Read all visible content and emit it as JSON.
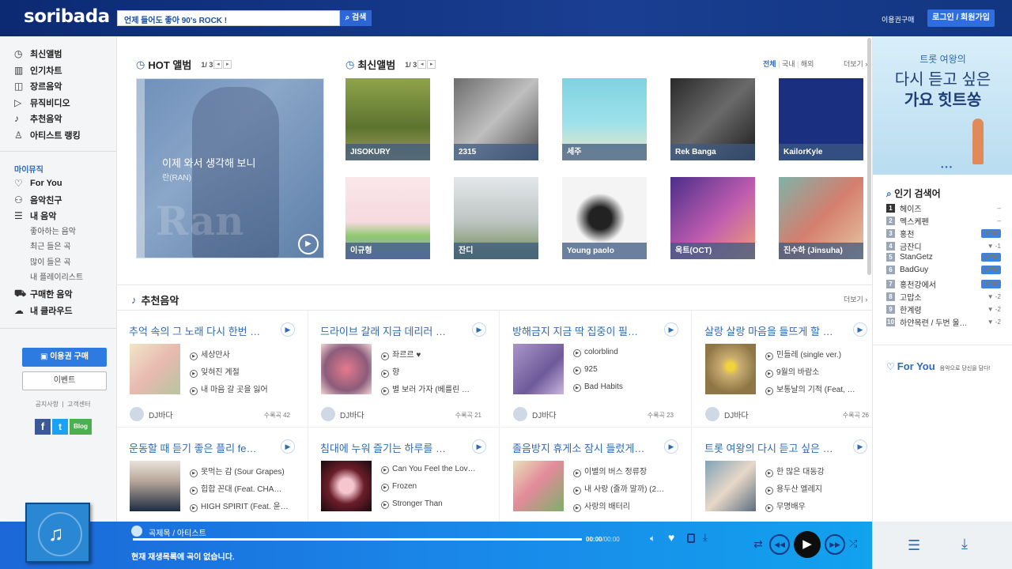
{
  "header": {
    "logo": "soribada",
    "search_value": "언제 들어도 좋아 90's ROCK !",
    "search_btn": "검색",
    "voucher": "이용권구매",
    "login": "로그인 / 회원가입"
  },
  "sidebar": {
    "menu": [
      {
        "label": "최신앨범",
        "icon": "clock-icon"
      },
      {
        "label": "인기차트",
        "icon": "chart-icon"
      },
      {
        "label": "장르음악",
        "icon": "genre-icon"
      },
      {
        "label": "뮤직비디오",
        "icon": "video-icon"
      },
      {
        "label": "추천음악",
        "icon": "note-icon"
      },
      {
        "label": "아티스트 랭킹",
        "icon": "person-icon"
      }
    ],
    "my_title": "마이뮤직",
    "for_you": "For You",
    "friends": "음악친구",
    "my_music": "내 음악",
    "subs": [
      "좋아하는 음악",
      "최근 들은 곡",
      "많이 들은 곡",
      "내 플레이리스트"
    ],
    "purchased": "구매한 음악",
    "cloud": "내 클라우드",
    "buy_btn": "이용권 구매",
    "event_btn": "이벤트",
    "notice": "공지사항",
    "support": "고객센터",
    "blog": "Blog"
  },
  "hot": {
    "title": "HOT 앨범",
    "page": "1/ 3",
    "song": "이제 와서 생각해 보니",
    "artist": "란(RAN)"
  },
  "latest": {
    "title": "최신앨범",
    "page": "1/ 3",
    "filters": [
      "전체",
      "국내",
      "해외"
    ],
    "more": "더보기 ›",
    "albums": [
      "JISOKURY",
      "2315",
      "세주",
      "Rek Banga",
      "KailorKyle",
      "이규형",
      "잔디",
      "Young paolo",
      "옥트(OCT)",
      "진수하 (Jinsuha)"
    ]
  },
  "recommend": {
    "title": "추천음악",
    "more": "더보기 ›",
    "cards": [
      {
        "title": "추억 속의 그 노래 다시 한번 …",
        "tracks": [
          "세상만사",
          "잊혀진 계절",
          "내 마음 갈 곳을 잃어"
        ],
        "dj": "DJ바다",
        "count": "수록곡 42"
      },
      {
        "title": "드라이브 갈래 지금 데리러 …",
        "tracks": [
          "좌르르 ♥",
          "향",
          "별 보러 가자 (베를린 …"
        ],
        "dj": "DJ바다",
        "count": "수록곡 21"
      },
      {
        "title": "방해금지 지금 딱 집중이 필…",
        "tracks": [
          "colorblind",
          "925",
          "Bad Habits"
        ],
        "dj": "DJ바다",
        "count": "수록곡 23"
      },
      {
        "title": "살랑 살랑 마음을 들뜨게 할 …",
        "tracks": [
          "민들레 (single ver.)",
          "9월의 바람소",
          "보통날의 기적 (Feat, …"
        ],
        "dj": "DJ바다",
        "count": "수록곡 26"
      },
      {
        "title": "운동할 때 듣기 좋은 플리 fe…",
        "tracks": [
          "못먹는 감 (Sour Grapes)",
          "힙합 꼰대 (Feat. CHA…",
          "HIGH SPIRIT (Feat. 윤…"
        ]
      },
      {
        "title": "침대에 누워 즐기는 하루를 …",
        "tracks": [
          "Can You Feel the Lov…",
          "Frozen",
          "Stronger Than"
        ]
      },
      {
        "title": "졸음방지 휴게소 잠시 들렀게…",
        "tracks": [
          "이별의 버스 정류장",
          "내 사랑 (줄까 말까) (2…",
          "사랑의 배터리"
        ]
      },
      {
        "title": "트롯 여왕의 다시 듣고 싶은 …",
        "tracks": [
          "한 많은 대동강",
          "용두산 엘레지",
          "무명배우"
        ]
      }
    ]
  },
  "banner": {
    "line1": "트롯 여왕의",
    "line2": "다시 듣고 싶은",
    "line3": "가요 힛트쏭"
  },
  "popular": {
    "title": "인기 검색어",
    "items": [
      {
        "rank": "1",
        "word": "헤이즈",
        "chg": "–"
      },
      {
        "rank": "2",
        "word": "멕스케펜",
        "chg": "–"
      },
      {
        "rank": "3",
        "word": "홍천",
        "chg": "NEW"
      },
      {
        "rank": "4",
        "word": "금잔디",
        "chg": "▼ -1"
      },
      {
        "rank": "5",
        "word": "StanGetz",
        "chg": "NEW"
      },
      {
        "rank": "6",
        "word": "BadGuy",
        "chg": "NEW"
      },
      {
        "rank": "7",
        "word": "홍천강에서",
        "chg": "NEW"
      },
      {
        "rank": "8",
        "word": "고맙소",
        "chg": "▼ -2"
      },
      {
        "rank": "9",
        "word": "한계령",
        "chg": "▼ -2"
      },
      {
        "rank": "10",
        "word": "하얀목련 / 두번 울…",
        "chg": "▼ -2"
      }
    ]
  },
  "foryou": {
    "title": "For You",
    "desc": "음악으로 당신을 담다!"
  },
  "player": {
    "title": "곡제목 / 아티스트",
    "time": "00:00",
    "total": "/00:00",
    "status": "현재 재생목록에 곡이 없습니다.",
    "progress": 0
  }
}
